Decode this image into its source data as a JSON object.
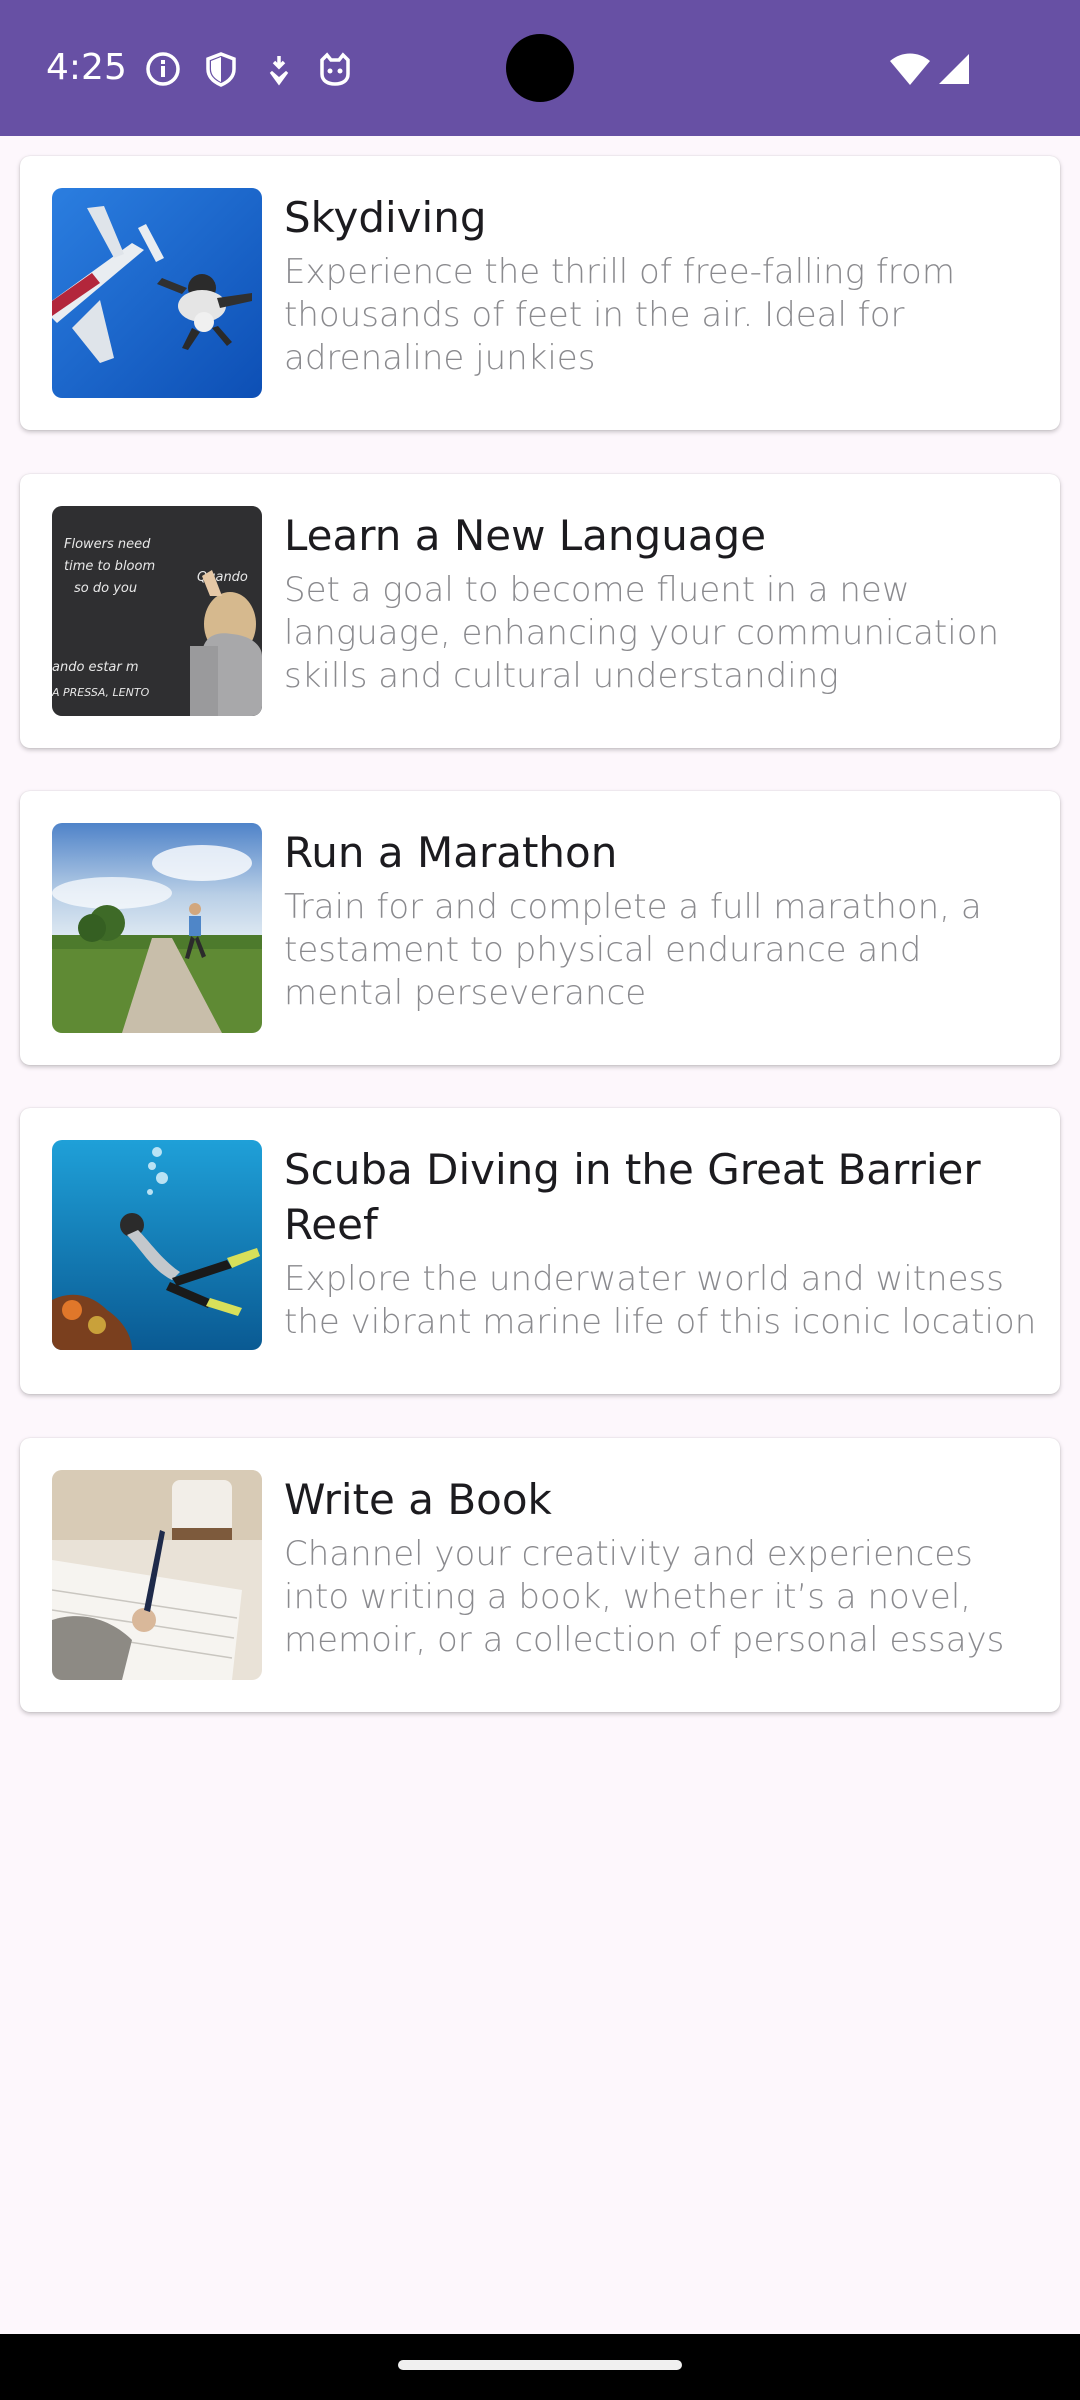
{
  "status_bar": {
    "time": "4:25",
    "icons_left": [
      "info-icon",
      "shield-icon",
      "download-notification-icon",
      "cat-face-icon"
    ],
    "icons_right": [
      "wifi-icon",
      "cell-signal-icon"
    ],
    "background_color": "#6750a4"
  },
  "goals": [
    {
      "title": "Skydiving",
      "description": "Experience the thrill of free-falling from thousands of feet in the air. Ideal for adrenaline junkies",
      "image": "skydiving-photo"
    },
    {
      "title": "Learn a New Language",
      "description": "Set a goal to become fluent in a new language, enhancing your communication skills and cultural understanding",
      "image": "chalkboard-language-photo",
      "chalk_lines": [
        "Flowers need",
        "time to bloom",
        "so do you",
        "Quando",
        "ando estar m",
        "A PRESSA, LENTO"
      ]
    },
    {
      "title": "Run a Marathon",
      "description": "Train for and complete a full marathon, a testament to physical endurance and mental perseverance",
      "image": "runner-road-photo"
    },
    {
      "title": "Scuba Diving in the Great Barrier Reef",
      "description": "Explore the underwater world and witness the vibrant marine life of this iconic location",
      "image": "scuba-diver-photo"
    },
    {
      "title": "Write a Book",
      "description": "Channel your creativity and experiences into writing a book, whether it’s a novel, memoir, or a collection of personal essays",
      "image": "writing-desk-photo"
    }
  ]
}
